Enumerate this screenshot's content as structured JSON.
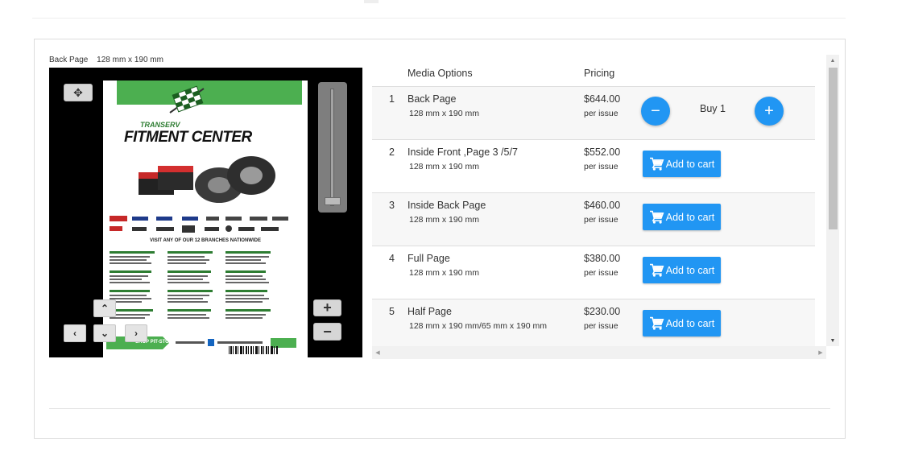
{
  "preview": {
    "media_name": "Back Page",
    "media_size": "128 mm x 190 mm"
  },
  "viewer": {
    "icons": {
      "move": "move-arrows-icon",
      "zoom_in": "plus-icon",
      "zoom_out": "minus-icon",
      "pan_up": "chevron-up-icon",
      "pan_down": "chevron-down-icon",
      "pan_left": "chevron-left-icon",
      "pan_right": "chevron-right-icon"
    },
    "ad": {
      "brand_small": "TRANSERV",
      "brand_large": "FITMENT CENTER",
      "visit_text": "VISIT ANY OF OUR 12 BRANCHES NATIONWIDE",
      "shop_text": "SHOP PIT-STOP",
      "colors": {
        "green": "#4caf50",
        "black": "#000000"
      }
    }
  },
  "table": {
    "headers": {
      "media": "Media Options",
      "pricing": "Pricing"
    },
    "rows": [
      {
        "num": "1",
        "name": "Back Page",
        "size": "128 mm x 190 mm",
        "price": "$644.00",
        "per": "per issue",
        "in_cart": true,
        "buy_label": "Buy 1"
      },
      {
        "num": "2",
        "name": "Inside Front ,Page 3 /5/7",
        "size": "128 mm x 190 mm",
        "price": "$552.00",
        "per": "per issue",
        "in_cart": false,
        "button_label": "Add to cart"
      },
      {
        "num": "3",
        "name": "Inside Back Page",
        "size": "128 mm x 190 mm",
        "price": "$460.00",
        "per": "per issue",
        "in_cart": false,
        "button_label": "Add to cart"
      },
      {
        "num": "4",
        "name": "Full Page",
        "size": "128 mm x 190 mm",
        "price": "$380.00",
        "per": "per issue",
        "in_cart": false,
        "button_label": "Add to cart"
      },
      {
        "num": "5",
        "name": "Half Page",
        "size": "128 mm x 190 mm/65 mm x 190 mm",
        "price": "$230.00",
        "per": "per issue",
        "in_cart": false,
        "button_label": "Add to cart"
      }
    ]
  },
  "colors": {
    "accent": "#2196f3"
  }
}
